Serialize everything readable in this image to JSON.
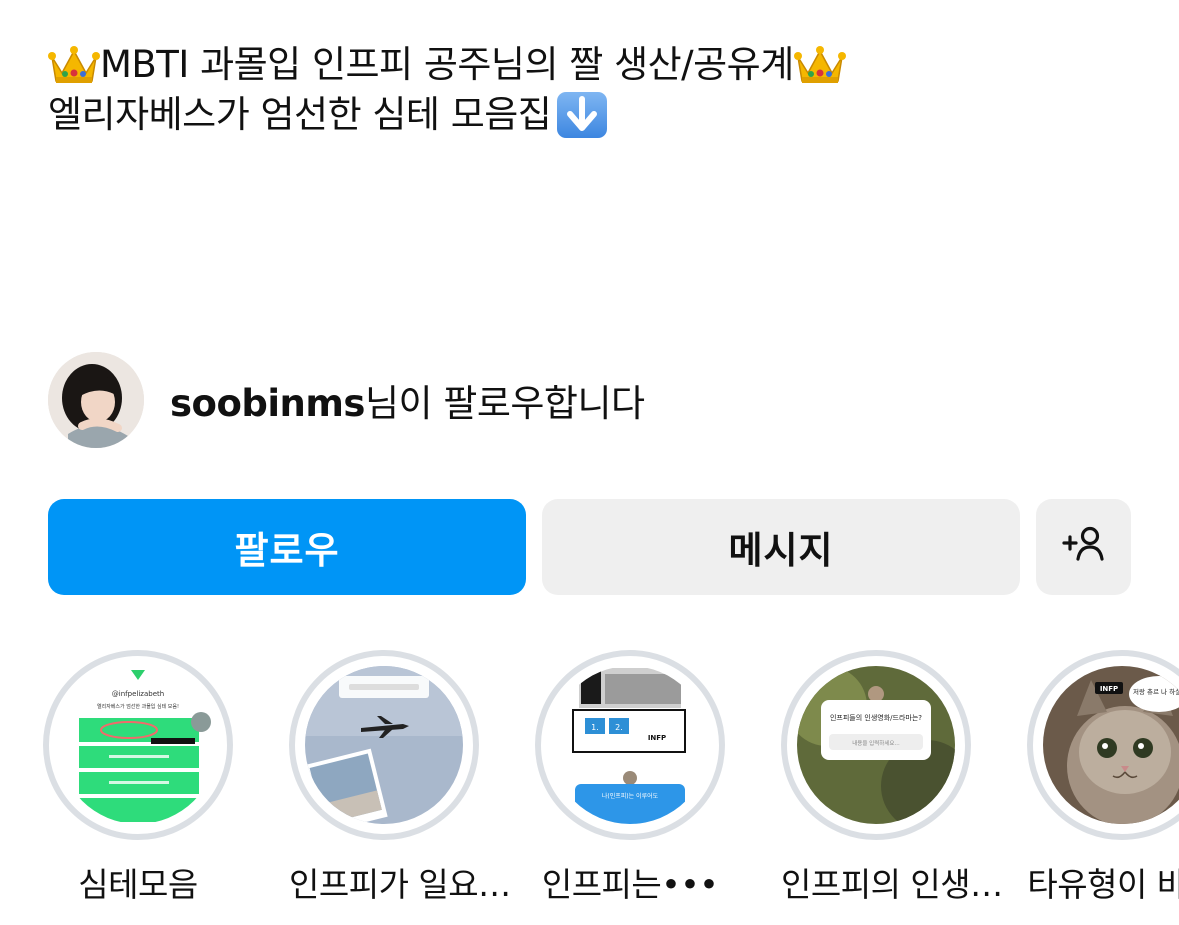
{
  "bio": {
    "line1": "MBTI 과몰입 인프피 공주님의 짤 생산/공유계",
    "line2": "엘리자베스가 엄선한 심테 모음집",
    "crown_icon": "crown-emoji",
    "arrow_icon": "down-arrow-emoji"
  },
  "followed_by": {
    "username": "soobinms",
    "suffix": "님이 팔로우합니다"
  },
  "buttons": {
    "follow": "팔로우",
    "message": "메시지",
    "add_person_icon": "add-person-icon"
  },
  "highlights": [
    {
      "label": "심테모음",
      "handle": "@infpelizabeth",
      "caption": "엘리자베스가 엄선한 과몰입 심테 모음!"
    },
    {
      "label": "인프피가 일요…"
    },
    {
      "label": "인프피는•••",
      "badge": "INFP",
      "caption": "나(인프피)는 이루어도"
    },
    {
      "label": "인프피의 인생…",
      "caption": "인프피들의 인생영화/드라마는?",
      "input_placeholder": "내용을 입력하세요..."
    },
    {
      "label": "타유형이 바라",
      "badge": "INFP",
      "caption": "저랑 츄르 나 하실래요"
    }
  ],
  "colors": {
    "follow_bg": "#0095f6",
    "secondary_bg": "#efefef",
    "ring": "#dbdfe4"
  }
}
